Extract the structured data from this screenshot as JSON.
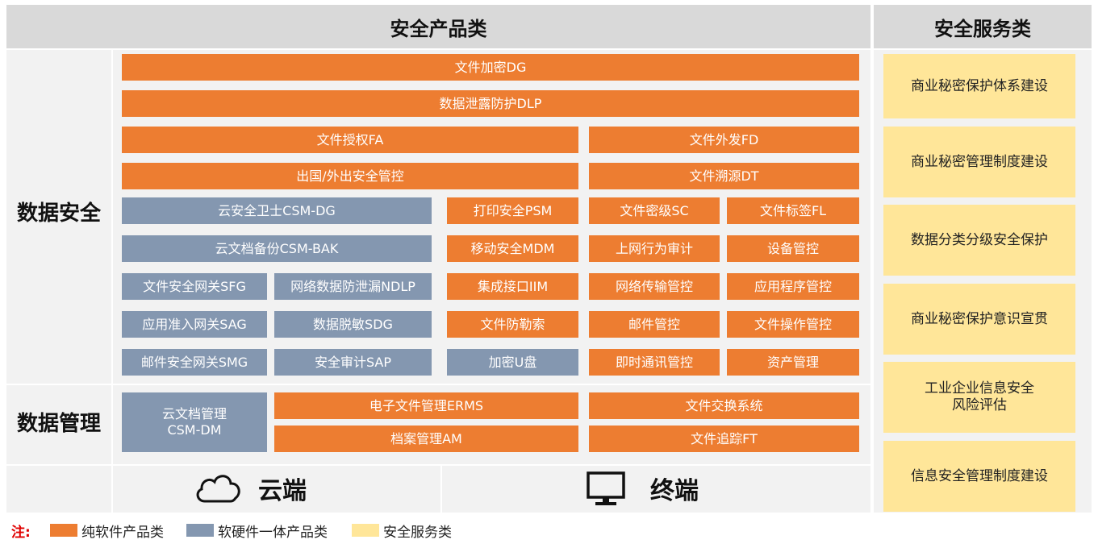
{
  "headers": {
    "products": "安全产品类",
    "services": "安全服务类"
  },
  "row_labels": {
    "data_security": "数据安全",
    "data_management": "数据管理"
  },
  "products": {
    "dg": "文件加密DG",
    "dlp": "数据泄露防护DLP",
    "fa": "文件授权FA",
    "fd": "文件外发FD",
    "export": "出国/外出安全管控",
    "dt": "文件溯源DT",
    "csm_dg": "云安全卫士CSM-DG",
    "psm": "打印安全PSM",
    "sc": "文件密级SC",
    "fl": "文件标签FL",
    "csm_bak": "云文档备份CSM-BAK",
    "mdm": "移动安全MDM",
    "web_audit": "上网行为审计",
    "device": "设备管控",
    "sfg": "文件安全网关SFG",
    "ndlp": "网络数据防泄漏NDLP",
    "iim": "集成接口IIM",
    "net_transfer": "网络传输管控",
    "app_ctrl": "应用程序管控",
    "sag": "应用准入网关SAG",
    "sdg": "数据脱敏SDG",
    "ransom": "文件防勒索",
    "mail_ctrl": "邮件管控",
    "file_op": "文件操作管控",
    "smg": "邮件安全网关SMG",
    "sap": "安全审计SAP",
    "u_disk": "加密U盘",
    "im_ctrl": "即时通讯管控",
    "asset": "资产管理",
    "csm_dm": "云文档管理\nCSM-DM",
    "erms": "电子文件管理ERMS",
    "exchange": "文件交换系统",
    "am": "档案管理AM",
    "ft": "文件追踪FT"
  },
  "footer": {
    "cloud": "云端",
    "terminal": "终端"
  },
  "services": [
    "商业秘密保护体系建设",
    "商业秘密管理制度建设",
    "数据分类分级安全保护",
    "商业秘密保护意识宣贯",
    "工业企业信息安全\n风险评估",
    "信息安全管理制度建设"
  ],
  "legend": {
    "note": "注:",
    "software": "纯软件产品类",
    "hardware": "软硬件一体产品类",
    "service": "安全服务类"
  },
  "colors": {
    "software": "#ed7d31",
    "hardware": "#8497b0",
    "service": "#ffe699",
    "note": "#e00000"
  },
  "icons": {
    "cloud": "cloud-icon",
    "terminal": "monitor-icon"
  }
}
